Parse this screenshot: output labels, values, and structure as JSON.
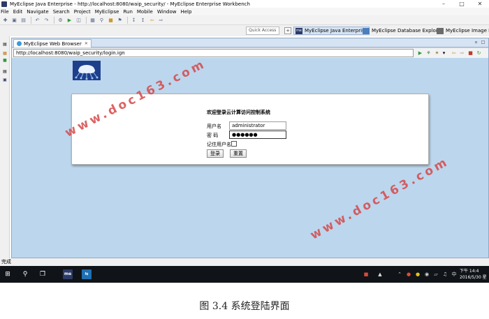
{
  "window": {
    "title": "MyEclipse Java Enterprise - http://localhost:8080/waip_security/ - MyEclipse Enterprise Workbench"
  },
  "menu": [
    "File",
    "Edit",
    "Navigate",
    "Search",
    "Project",
    "MyEclipse",
    "Run",
    "Mobile",
    "Window",
    "Help"
  ],
  "perspectives": {
    "quick_access": "Quick Access",
    "items": [
      {
        "label": "MyEclipse Java Enterprise",
        "active": true
      },
      {
        "label": "MyEclipse Database Explorer",
        "active": false
      },
      {
        "label": "MyEclipse Image Edi",
        "active": false
      }
    ]
  },
  "browser": {
    "tab_label": "MyEclipse Web Browser",
    "url": "http://localhost:8080/waip_security/login.ign"
  },
  "login": {
    "title": "欢迎登录云计算访问控制系统",
    "username_label": "用户名",
    "username_value": "administrator",
    "password_label": "密  码",
    "password_value": "●●●●●●",
    "remember_label": "记住用户名",
    "remember_checked": false,
    "login_button": "登录",
    "reset_button": "重置"
  },
  "status_text": "完成",
  "taskbar": {
    "time": "下午 14:4",
    "date": "2016/5/30 星"
  },
  "watermark": "www.doc163.com",
  "caption": "图 3.4  系统登陆界面",
  "colors": {
    "page_background": "#bcd6ed",
    "watermark": "#d64848",
    "taskbar": "#101418"
  }
}
